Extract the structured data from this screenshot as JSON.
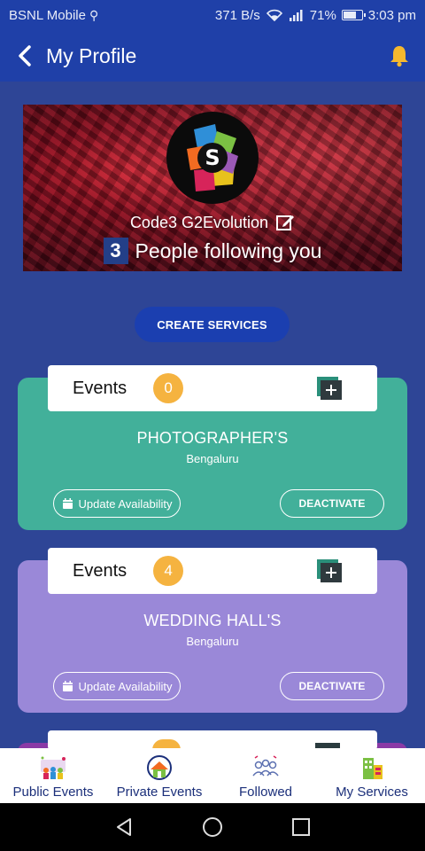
{
  "status_bar": {
    "carrier": "BSNL Mobile",
    "net_speed": "371 B/s",
    "battery": "71%",
    "time": "3:03 pm"
  },
  "app_bar": {
    "title": "My Profile"
  },
  "profile": {
    "name": "Code3 G2Evolution",
    "follower_count": "3",
    "follower_text": "People following you"
  },
  "create_button": "CREATE SERVICES",
  "services": [
    {
      "category": "Events",
      "count": "0",
      "title": "PHOTOGRAPHER'S",
      "city": "Bengaluru",
      "update_label": "Update Availability",
      "deactivate_label": "DEACTIVATE",
      "color": "#42b09a"
    },
    {
      "category": "Events",
      "count": "4",
      "title": "WEDDING HALL'S",
      "city": "Bengaluru",
      "update_label": "Update Availability",
      "deactivate_label": "DEACTIVATE",
      "color": "#9a88d8"
    }
  ],
  "bottom_nav": [
    {
      "label": "Public Events",
      "icon": "public-events-icon"
    },
    {
      "label": "Private Events",
      "icon": "private-events-icon"
    },
    {
      "label": "Followed",
      "icon": "followed-icon"
    },
    {
      "label": "My Services",
      "icon": "my-services-icon"
    }
  ],
  "colors": {
    "primary": "#1f40a8",
    "background": "#2e4596",
    "badge": "#f5b340"
  }
}
